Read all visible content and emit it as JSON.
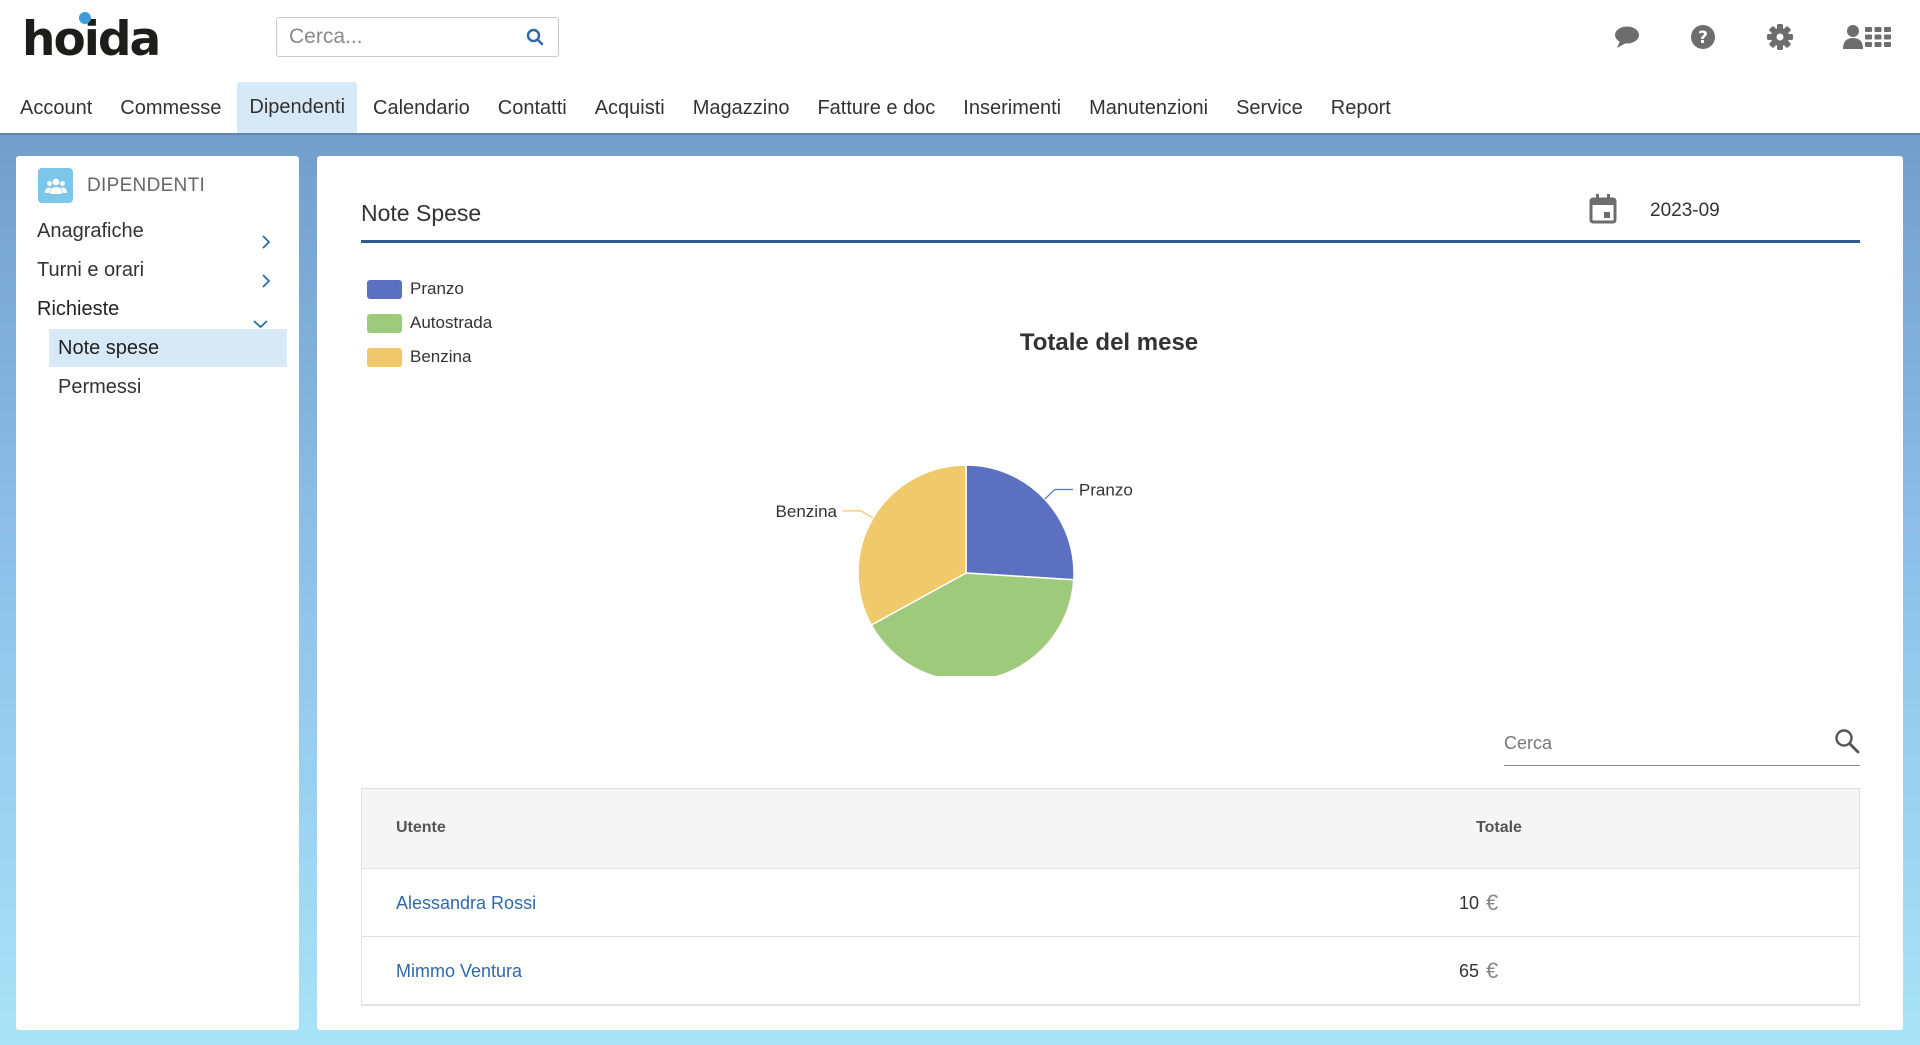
{
  "app": {
    "logo": "hoida",
    "accent": "#3e9ad8"
  },
  "search": {
    "placeholder": "Cerca..."
  },
  "top_icons": [
    "chat-icon",
    "help-icon",
    "settings-icon",
    "user-icon",
    "apps-grid-icon"
  ],
  "nav": {
    "items": [
      {
        "label": "Account"
      },
      {
        "label": "Commesse"
      },
      {
        "label": "Dipendenti",
        "active": true
      },
      {
        "label": "Calendario"
      },
      {
        "label": "Contatti"
      },
      {
        "label": "Acquisti"
      },
      {
        "label": "Magazzino"
      },
      {
        "label": "Fatture e doc"
      },
      {
        "label": "Inserimenti"
      },
      {
        "label": "Manutenzioni"
      },
      {
        "label": "Service"
      },
      {
        "label": "Report"
      }
    ]
  },
  "sidebar": {
    "title": "DIPENDENTI",
    "items": [
      {
        "label": "Anagrafiche"
      },
      {
        "label": "Turni e orari"
      },
      {
        "label": "Richieste",
        "expanded": true
      }
    ],
    "subitems": [
      {
        "label": "Note spese",
        "active": true
      },
      {
        "label": "Permessi"
      }
    ]
  },
  "main": {
    "title": "Note Spese",
    "month": "2023-09",
    "table_search_placeholder": "Cerca",
    "table": {
      "headers": [
        "Utente",
        "Totale"
      ],
      "rows": [
        {
          "user": "Alessandra Rossi",
          "total": "10",
          "currency": "€"
        },
        {
          "user": "Mimmo Ventura",
          "total": "65",
          "currency": "€"
        }
      ]
    }
  },
  "chart_data": {
    "type": "pie",
    "title": "Totale del mese",
    "categories": [
      "Pranzo",
      "Autostrada",
      "Benzina"
    ],
    "values": [
      26,
      41,
      33
    ],
    "colors": [
      "#5b70c0",
      "#9fca7c",
      "#f0c96b"
    ],
    "legend": "top-left"
  }
}
